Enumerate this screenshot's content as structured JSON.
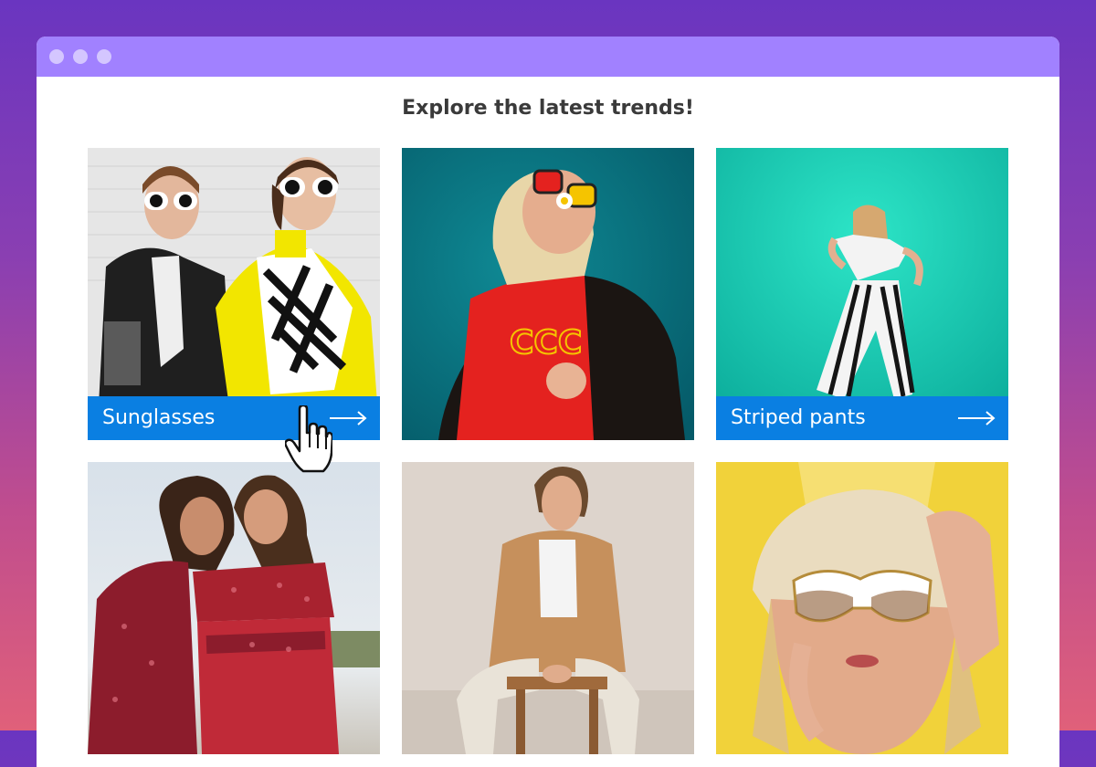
{
  "window": {
    "controls": [
      "window-dot",
      "window-dot",
      "window-dot"
    ]
  },
  "page": {
    "title": "Explore the latest trends!"
  },
  "cards": [
    {
      "label": "Sunglasses",
      "icon": "arrow-right-icon"
    },
    {
      "label": ""
    },
    {
      "label": "Striped pants",
      "icon": "arrow-right-icon"
    },
    {
      "label": ""
    },
    {
      "label": ""
    },
    {
      "label": ""
    }
  ],
  "colors": {
    "background_top": "#6a35c0",
    "background_bottom": "#e0607a",
    "titlebar": "#a181ff",
    "label_bar": "#0a7fe2"
  },
  "cursor": "hand-pointer-icon"
}
